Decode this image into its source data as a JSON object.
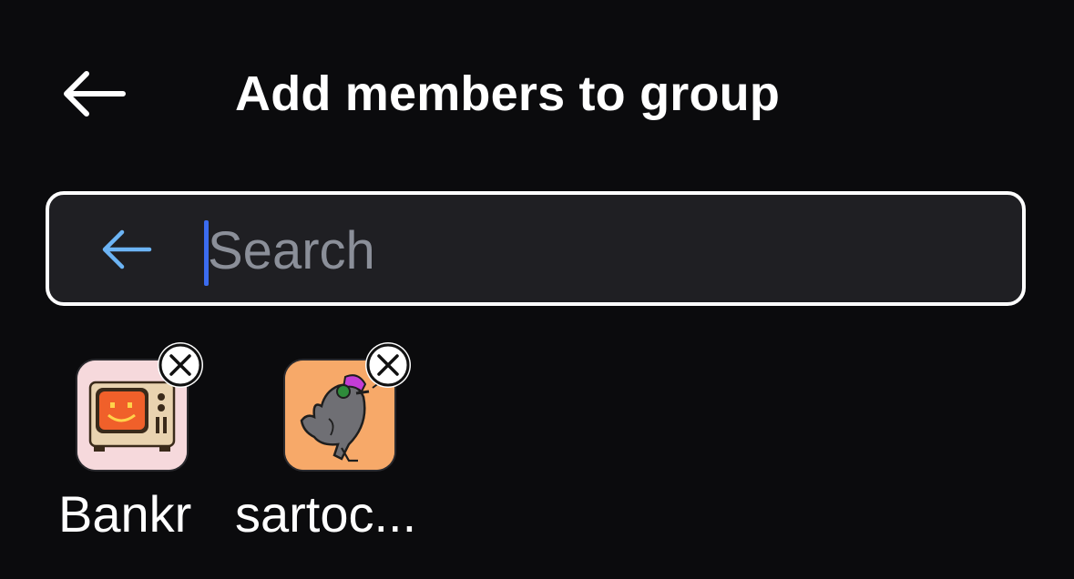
{
  "header": {
    "title": "Add members to group",
    "back_icon": "arrow-left-icon"
  },
  "search": {
    "placeholder": "Search",
    "value": "",
    "back_icon": "arrow-left-icon",
    "back_icon_color": "#6cb4f5",
    "caret_color": "#3b6cf0"
  },
  "selected_members": [
    {
      "name": "Bankr",
      "avatar": "retro-tv-smiley-avatar",
      "avatar_bg": "#f6d9dc",
      "remove_icon": "close-circle-icon"
    },
    {
      "name": "sartoc...",
      "avatar": "cartoon-bird-headphones-avatar",
      "avatar_bg": "#f7a969",
      "remove_icon": "close-circle-icon"
    }
  ],
  "colors": {
    "background": "#0b0b0d",
    "search_background": "#1f1f23",
    "search_border": "#ffffff",
    "placeholder": "#8b8f99"
  }
}
